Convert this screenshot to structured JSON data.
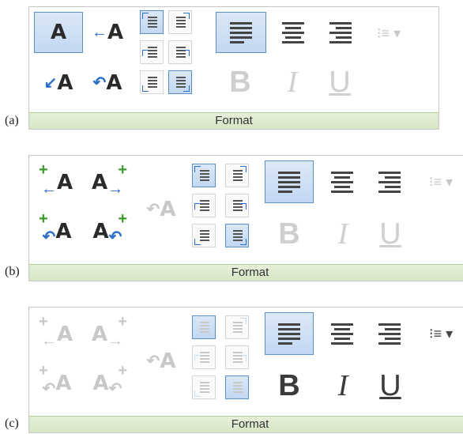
{
  "panels": [
    {
      "label": "(a)",
      "footer": "Format"
    },
    {
      "label": "(b)",
      "footer": "Format"
    },
    {
      "label": "(c)",
      "footer": "Format"
    }
  ],
  "glyphs": {
    "a": "A",
    "bold": "B",
    "italic": "I",
    "underline": "U",
    "arrow_left": "←",
    "arrow_right": "→",
    "arrow_curve_left": "↙",
    "arrow_curve_down": "↶",
    "plus": "+",
    "list": "⁝≡ ▾"
  },
  "icons": {
    "align_left": "align-left-icon",
    "align_center": "align-center-icon",
    "align_right": "align-right-icon",
    "list": "list-dropdown-icon"
  },
  "colors": {
    "selected_bg": "#c2d8f2",
    "selected_border": "#5b8dd0",
    "footer_bg": "#d7e6c4",
    "arrow_blue": "#2b6fc9",
    "plus_green": "#3a9a2a"
  }
}
